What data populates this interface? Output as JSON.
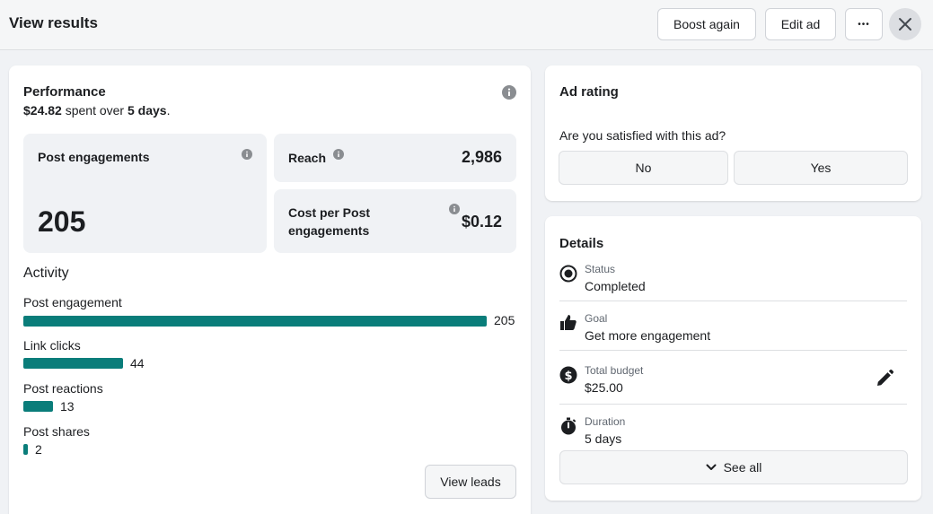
{
  "header": {
    "title": "View results",
    "boost_label": "Boost again",
    "edit_label": "Edit ad",
    "more_label": "•••"
  },
  "performance": {
    "title": "Performance",
    "spent_amount": "$24.82",
    "spent_mid": " spent over ",
    "spent_days": "5 days",
    "spent_end": ".",
    "metrics": {
      "engagements_label": "Post engagements",
      "engagements_value": "205",
      "reach_label": "Reach",
      "reach_value": "2,986",
      "cost_label_1": "Cost per Post",
      "cost_label_2": "engagements",
      "cost_value": "$0.12"
    },
    "activity_title": "Activity",
    "activity": [
      {
        "label": "Post engagement",
        "value": "205",
        "count": 205
      },
      {
        "label": "Link clicks",
        "value": "44",
        "count": 44
      },
      {
        "label": "Post reactions",
        "value": "13",
        "count": 13
      },
      {
        "label": "Post shares",
        "value": "2",
        "count": 2
      }
    ],
    "view_leads_label": "View leads"
  },
  "rating": {
    "title": "Ad rating",
    "question": "Are you satisfied with this ad?",
    "no_label": "No",
    "yes_label": "Yes"
  },
  "details": {
    "title": "Details",
    "rows": [
      {
        "label": "Status",
        "value": "Completed",
        "icon": "status-icon"
      },
      {
        "label": "Goal",
        "value": "Get more engagement",
        "icon": "thumbs-up-icon"
      },
      {
        "label": "Total budget",
        "value": "$25.00",
        "icon": "dollar-icon"
      },
      {
        "label": "Duration",
        "value": "5 days",
        "icon": "stopwatch-icon"
      }
    ],
    "see_all_label": "See all"
  },
  "colors": {
    "bar": "#0a7d7a",
    "background": "#f0f2f5"
  }
}
